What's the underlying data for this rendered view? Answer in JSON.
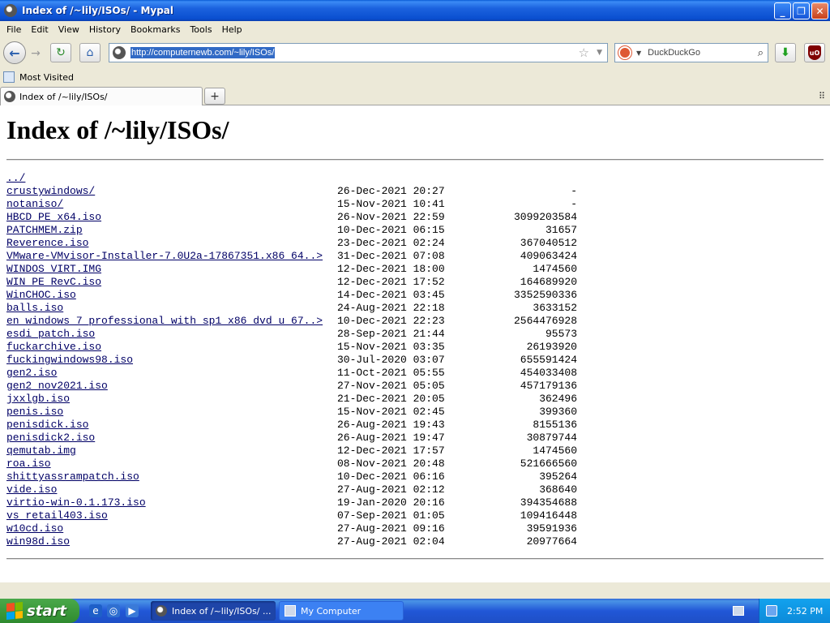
{
  "window": {
    "title": "Index of /~lily/ISOs/ - Mypal"
  },
  "menu": [
    "File",
    "Edit",
    "View",
    "History",
    "Bookmarks",
    "Tools",
    "Help"
  ],
  "nav": {
    "url": "http://computernewb.com/~lily/ISOs/"
  },
  "search": {
    "engine": "DuckDuckGo",
    "placeholder": "DuckDuckGo"
  },
  "bookmarks": {
    "most_visited": "Most Visited"
  },
  "tab": {
    "title": "Index of /~lily/ISOs/"
  },
  "page": {
    "heading": "Index of /~lily/ISOs/",
    "entries": [
      {
        "name": "../",
        "date": "",
        "size": ""
      },
      {
        "name": "crustywindows/",
        "date": "26-Dec-2021 20:27",
        "size": "-"
      },
      {
        "name": "notaniso/",
        "date": "15-Nov-2021 10:41",
        "size": "-"
      },
      {
        "name": "HBCD PE x64.iso",
        "date": "26-Nov-2021 22:59",
        "size": "3099203584"
      },
      {
        "name": "PATCHMEM.zip",
        "date": "10-Dec-2021 06:15",
        "size": "31657"
      },
      {
        "name": "Reverence.iso",
        "date": "23-Dec-2021 02:24",
        "size": "367040512"
      },
      {
        "name": "VMware-VMvisor-Installer-7.0U2a-17867351.x86 64..>",
        "date": "31-Dec-2021 07:08",
        "size": "409063424"
      },
      {
        "name": "WINDOS VIRT.IMG",
        "date": "12-Dec-2021 18:00",
        "size": "1474560"
      },
      {
        "name": "WIN PE RevC.iso",
        "date": "12-Dec-2021 17:52",
        "size": "164689920"
      },
      {
        "name": "WinCHOC.iso",
        "date": "14-Dec-2021 03:45",
        "size": "3352590336"
      },
      {
        "name": "balls.iso",
        "date": "24-Aug-2021 22:18",
        "size": "3633152"
      },
      {
        "name": "en windows 7 professional with sp1 x86 dvd u 67..>",
        "date": "10-Dec-2021 22:23",
        "size": "2564476928"
      },
      {
        "name": "esdi patch.iso",
        "date": "28-Sep-2021 21:44",
        "size": "95573"
      },
      {
        "name": "fuckarchive.iso",
        "date": "15-Nov-2021 03:35",
        "size": "26193920"
      },
      {
        "name": "fuckingwindows98.iso",
        "date": "30-Jul-2020 03:07",
        "size": "655591424"
      },
      {
        "name": "gen2.iso",
        "date": "11-Oct-2021 05:55",
        "size": "454033408"
      },
      {
        "name": "gen2 nov2021.iso",
        "date": "27-Nov-2021 05:05",
        "size": "457179136"
      },
      {
        "name": "jxxlgb.iso",
        "date": "21-Dec-2021 20:05",
        "size": "362496"
      },
      {
        "name": "penis.iso",
        "date": "15-Nov-2021 02:45",
        "size": "399360"
      },
      {
        "name": "penisdick.iso",
        "date": "26-Aug-2021 19:43",
        "size": "8155136"
      },
      {
        "name": "penisdick2.iso",
        "date": "26-Aug-2021 19:47",
        "size": "30879744"
      },
      {
        "name": "qemutab.img",
        "date": "12-Dec-2021 17:57",
        "size": "1474560"
      },
      {
        "name": "roa.iso",
        "date": "08-Nov-2021 20:48",
        "size": "521666560"
      },
      {
        "name": "shittyassrampatch.iso",
        "date": "10-Dec-2021 06:16",
        "size": "395264"
      },
      {
        "name": "vide.iso",
        "date": "27-Aug-2021 02:12",
        "size": "368640"
      },
      {
        "name": "virtio-win-0.1.173.iso",
        "date": "19-Jan-2020 20:16",
        "size": "394354688"
      },
      {
        "name": "vs retail403.iso",
        "date": "07-Sep-2021 01:05",
        "size": "109416448"
      },
      {
        "name": "w10cd.iso",
        "date": "27-Aug-2021 09:16",
        "size": "39591936"
      },
      {
        "name": "win98d.iso",
        "date": "27-Aug-2021 02:04",
        "size": "20977664"
      }
    ]
  },
  "taskbar": {
    "start_label": "start",
    "tasks": [
      "Index of /~lily/ISOs/ ...",
      "My Computer"
    ],
    "clock": "2:52 PM"
  },
  "colors": {
    "link": "#000066",
    "titlebar": "#0a4fd0",
    "taskbar": "#245edb",
    "start": "#3c9a3c"
  }
}
